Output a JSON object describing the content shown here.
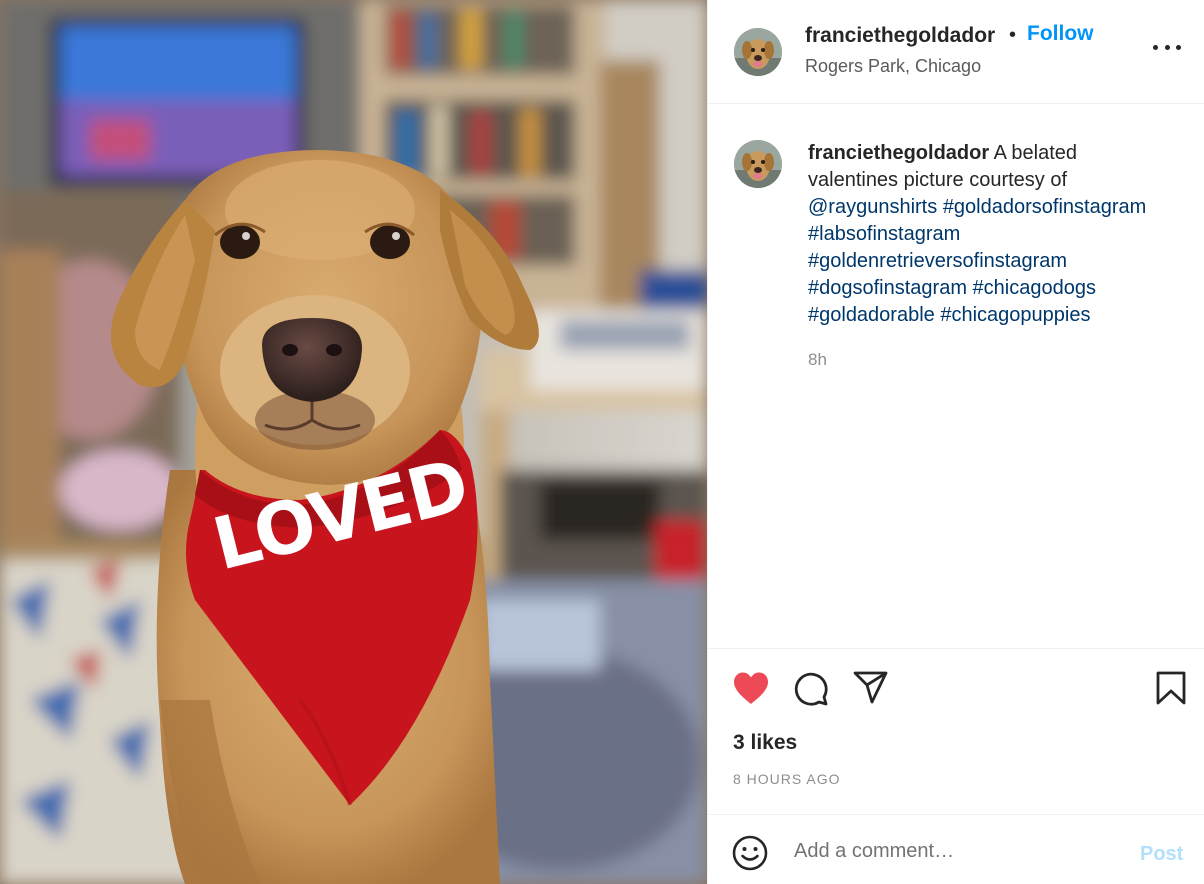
{
  "post": {
    "image_alt": "Yellow dog wearing a red bandana",
    "bandana_text": "LOVED",
    "author": {
      "username": "franciethegoldador",
      "location": "Rogers Park, Chicago",
      "follow_label": "Follow",
      "separator": "•"
    },
    "caption": {
      "username": "franciethegoldador",
      "text_line1": "A belated",
      "text_line2": "valentines picture courtesy of",
      "mention": "@raygunshirts",
      "hashtags": [
        "#goldadorsofinstagram",
        "#labsofinstagram",
        "#goldenretrieversofinstagram",
        "#dogsofinstagram",
        "#chicagodogs",
        "#goldadorable",
        "#chicagopuppies"
      ],
      "time": "8h"
    },
    "actions": {
      "like_icon": "heart-filled-icon",
      "comment_icon": "comment-bubble-icon",
      "share_icon": "paper-plane-icon",
      "save_icon": "bookmark-icon",
      "liked": true
    },
    "likes": "3 likes",
    "time_ago": "8 HOURS AGO",
    "comment_box": {
      "emoji_icon": "smiley-icon",
      "placeholder": "Add a comment…",
      "value": "",
      "post_label": "Post"
    }
  },
  "colors": {
    "accent": "#0095f6",
    "like_red": "#ed4956",
    "link": "#00376b",
    "muted": "#8e8e8e",
    "post_disabled": "#b2dffc",
    "bandana": "#c8141c"
  }
}
